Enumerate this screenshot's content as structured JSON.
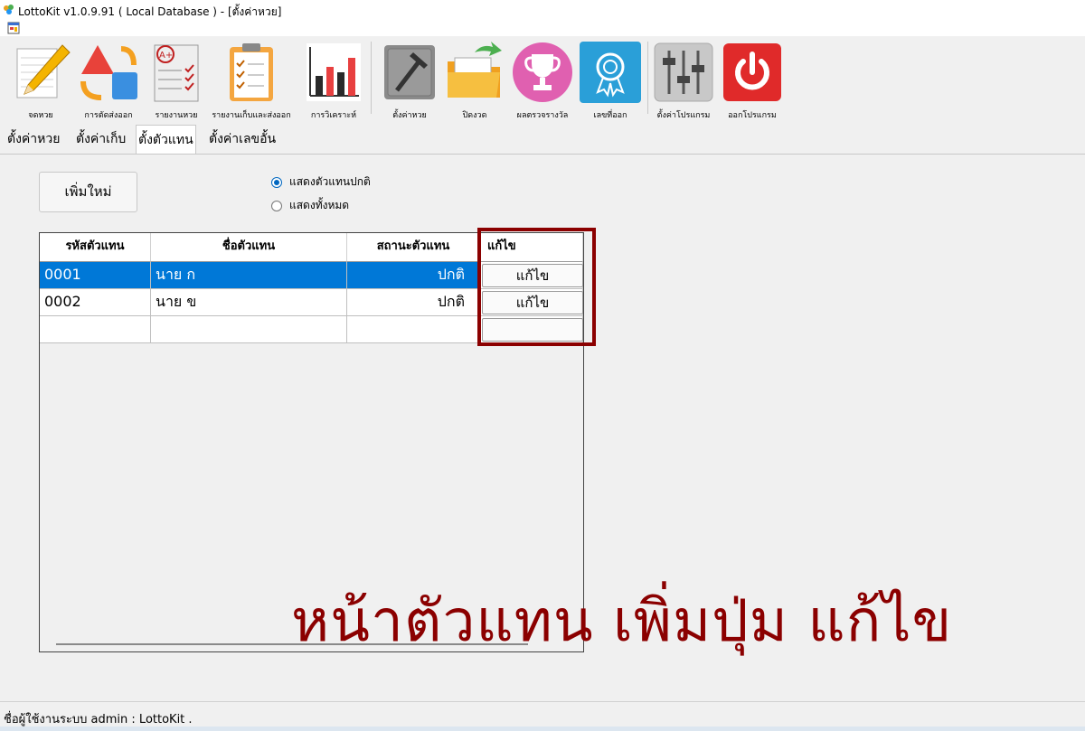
{
  "window": {
    "title": "LottoKit v1.0.9.91 ( Local Database  ) - [ตั้งค่าหวย]"
  },
  "toolbar": {
    "buttons": [
      {
        "label": "จดหวย",
        "icon": "pencil-paper-icon"
      },
      {
        "label": "การตัดส่งออก",
        "icon": "shapes-exchange-icon"
      },
      {
        "label": "รายงานหวย",
        "icon": "graded-report-icon"
      },
      {
        "label": "รายงานเก็บและส่งออก",
        "icon": "clipboard-checklist-icon"
      },
      {
        "label": "การวิเคราะห์",
        "icon": "bar-chart-icon"
      },
      {
        "label": "ตั้งค่าหวย",
        "icon": "hammer-icon"
      },
      {
        "label": "ปิดงวด",
        "icon": "folder-export-icon"
      },
      {
        "label": "ผลตรวจรางวัล",
        "icon": "trophy-icon"
      },
      {
        "label": "เลขที่ออก",
        "icon": "award-badge-icon"
      },
      {
        "label": "ตั้งค่าโปรแกรม",
        "icon": "sliders-icon"
      },
      {
        "label": "ออกโปรแกรม",
        "icon": "power-icon"
      }
    ]
  },
  "tabs": [
    {
      "label": "ตั้งค่าหวย",
      "active": false
    },
    {
      "label": "ตั้งค่าเก็บ",
      "active": false
    },
    {
      "label": "ตั้งตัวแทน",
      "active": true
    },
    {
      "label": "ตั้งค่าเลขอั้น",
      "active": false
    }
  ],
  "form": {
    "add_button": "เพิ่มใหม่",
    "filter": {
      "options": [
        "แสดงตัวแทนปกติ",
        "แสดงทั้งหมด"
      ],
      "selected": "แสดงตัวแทนปกติ"
    }
  },
  "grid": {
    "columns": [
      "รหัสตัวแทน",
      "ชื่อตัวแทน",
      "สถานะตัวแทน",
      "แก้ไข"
    ],
    "rows": [
      {
        "code": "0001",
        "name": "นาย ก",
        "status": "ปกติ",
        "action": "แก้ไข",
        "selected": true
      },
      {
        "code": "0002",
        "name": "นาย ข",
        "status": "ปกติ",
        "action": "แก้ไข",
        "selected": false
      }
    ]
  },
  "annotation": {
    "text": "หน้าตัวแทน  เพิ่มปุ่ม  แก้ไข",
    "color": "#8b0000"
  },
  "status": {
    "text": "ชื่อผู้ใช้งานระบบ admin : LottoKit ."
  },
  "colors": {
    "selection": "#0078d7",
    "highlight_frame": "#8b0000",
    "radio_accent": "#0067c0"
  }
}
